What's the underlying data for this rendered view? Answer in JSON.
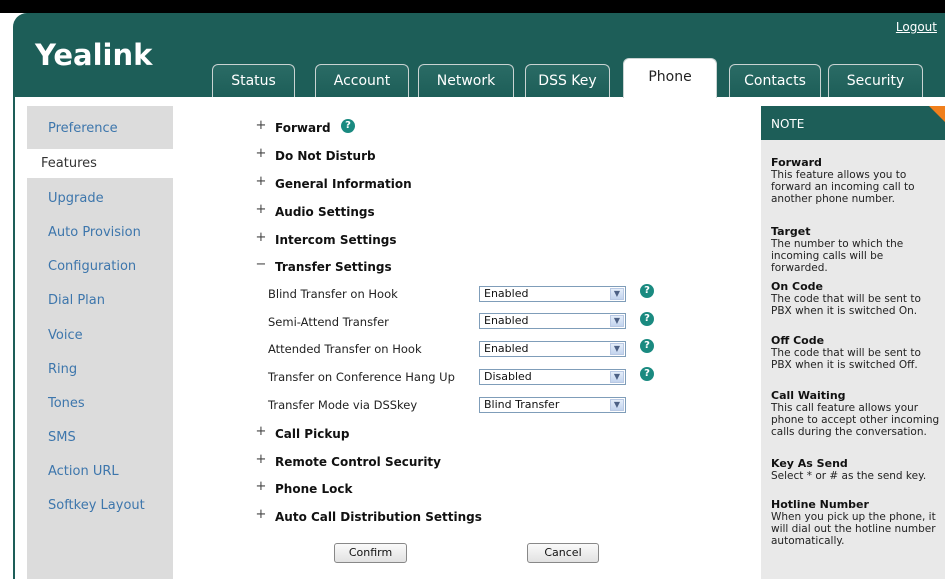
{
  "header": {
    "logo": "Yealink",
    "logout": "Logout"
  },
  "tabs": [
    {
      "label": "Status"
    },
    {
      "label": "Account"
    },
    {
      "label": "Network"
    },
    {
      "label": "DSS Key"
    },
    {
      "label": "Phone"
    },
    {
      "label": "Contacts"
    },
    {
      "label": "Security"
    }
  ],
  "active_tab": "Phone",
  "sidebar": {
    "items": [
      {
        "label": "Preference"
      },
      {
        "label": "Features"
      },
      {
        "label": "Upgrade"
      },
      {
        "label": "Auto Provision"
      },
      {
        "label": "Configuration"
      },
      {
        "label": "Dial Plan"
      },
      {
        "label": "Voice"
      },
      {
        "label": "Ring"
      },
      {
        "label": "Tones"
      },
      {
        "label": "SMS"
      },
      {
        "label": "Action URL"
      },
      {
        "label": "Softkey Layout"
      }
    ],
    "active": "Features"
  },
  "sections": {
    "forward": "Forward",
    "dnd": "Do Not Disturb",
    "general": "General Information",
    "audio": "Audio Settings",
    "intercom": "Intercom Settings",
    "transfer": "Transfer Settings",
    "pickup": "Call Pickup",
    "remote": "Remote Control Security",
    "lock": "Phone Lock",
    "acd": "Auto Call Distribution Settings"
  },
  "transfer_rows": [
    {
      "label": "Blind Transfer on Hook",
      "value": "Enabled"
    },
    {
      "label": "Semi-Attend Transfer",
      "value": "Enabled"
    },
    {
      "label": "Attended Transfer on Hook",
      "value": "Enabled"
    },
    {
      "label": "Transfer on Conference Hang Up",
      "value": "Disabled"
    },
    {
      "label": "Transfer Mode via DSSkey",
      "value": "Blind Transfer"
    }
  ],
  "buttons": {
    "confirm": "Confirm",
    "cancel": "Cancel"
  },
  "note": {
    "title": "NOTE",
    "entries": [
      {
        "title": "Forward",
        "text": "This feature allows you to forward an incoming call to another phone number."
      },
      {
        "title": "Target",
        "text": "The number to which the incoming calls will be forwarded."
      },
      {
        "title": "On Code",
        "text": "The code that will be sent to PBX when it is switched On."
      },
      {
        "title": "Off Code",
        "text": "The code that will be sent to PBX when it is switched Off."
      },
      {
        "title": "Call Waiting",
        "text": "This call feature allows your phone to accept other incoming calls during the conversation."
      },
      {
        "title": "Key As Send",
        "text": "Select * or # as the send key."
      },
      {
        "title": "Hotline Number",
        "text": "When you pick up the phone, it will dial out the hotline number automatically."
      }
    ]
  },
  "colors": {
    "brand": "#1d5e58",
    "link": "#3d76ac",
    "accent": "#f07f1c",
    "help": "#1a8a80"
  }
}
